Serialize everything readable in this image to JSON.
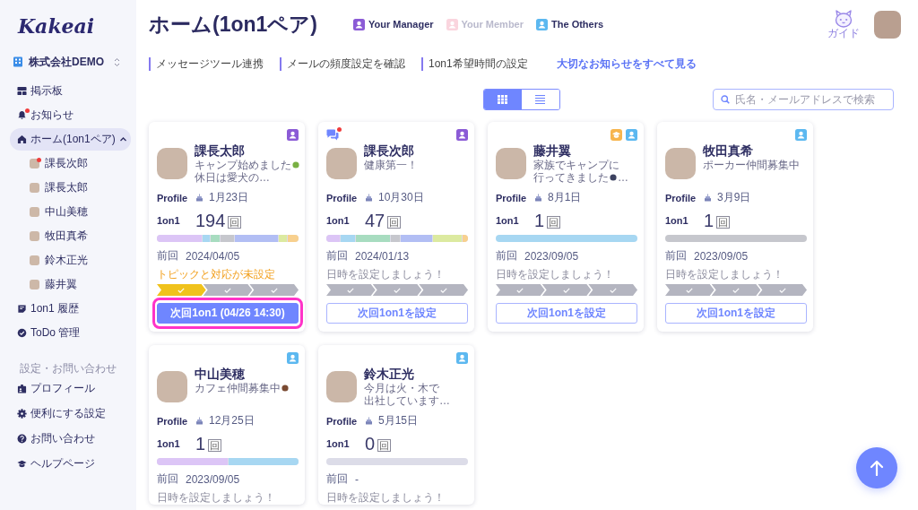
{
  "sidebar": {
    "logo": "Kakeai",
    "company": "株式会社DEMO",
    "items": [
      {
        "label": "掲示板",
        "selected": false,
        "unread": false
      },
      {
        "label": "お知らせ",
        "selected": false,
        "unread": true
      },
      {
        "label": "ホーム(1on1ペア)",
        "selected": true,
        "unread": false,
        "expanded": true,
        "children": [
          {
            "label": "課長次郎",
            "unread": true
          },
          {
            "label": "課長太郎",
            "unread": false
          },
          {
            "label": "中山美穂",
            "unread": false
          },
          {
            "label": "牧田真希",
            "unread": false
          },
          {
            "label": "鈴木正光",
            "unread": false
          },
          {
            "label": "藤井翼",
            "unread": false
          }
        ]
      },
      {
        "label": "1on1 履歴",
        "selected": false,
        "unread": false
      },
      {
        "label": "ToDo 管理",
        "selected": false,
        "unread": false
      }
    ],
    "section_title": "設定・お問い合わせ",
    "settings_items": [
      {
        "label": "プロフィール",
        "selected": false
      },
      {
        "label": "便利にする設定",
        "selected": false
      },
      {
        "label": "お問い合わせ",
        "selected": false
      },
      {
        "label": "ヘルプページ",
        "selected": false
      }
    ]
  },
  "header": {
    "title": "ホーム(1on1ペア)",
    "legend": [
      {
        "label": "Your Manager",
        "kind": "manager",
        "disabled": false
      },
      {
        "label": "Your Member",
        "kind": "member",
        "disabled": true
      },
      {
        "label": "The Others",
        "kind": "other",
        "disabled": false
      }
    ],
    "guide": "ガイド",
    "links": [
      "メッセージツール連携",
      "メールの頻度設定を確認",
      "1on1希望時間の設定"
    ],
    "notice_link": "大切なお知らせをすべて見る",
    "view_toggle": [
      {
        "kind": "grid",
        "selected": true
      },
      {
        "kind": "list",
        "selected": false
      }
    ],
    "search": {
      "placeholder": "氏名・メールアドレスで検索"
    }
  },
  "cards": [
    {
      "name": "課長太郎",
      "unread_message": false,
      "roles": [
        {
          "kind": "manager"
        }
      ],
      "status": [
        [
          {
            "kind": "text",
            "text": "キャンプ始めました"
          },
          {
            "kind": "emoji",
            "color": "#79b043"
          }
        ],
        [
          {
            "kind": "text",
            "text": "休日は愛犬の…"
          }
        ]
      ],
      "profile_label": "Profile",
      "birthday": "1月23日",
      "count_label": "1on1",
      "count": "194",
      "count_unit": "回",
      "last_label": "前回",
      "last_date": "2024/04/05",
      "notice": {
        "text": "トピックと対応が未設定",
        "warning": true
      },
      "steps": [
        {
          "done": true
        },
        {
          "done": false
        },
        {
          "done": false
        }
      ],
      "button": {
        "label": "次回1on1 (04/26 14:30)",
        "filled": true,
        "highlighted": true
      }
    },
    {
      "name": "課長次郎",
      "unread_message": true,
      "roles": [
        {
          "kind": "manager"
        }
      ],
      "status": [
        [
          {
            "kind": "text",
            "text": "健康第一！"
          }
        ]
      ],
      "profile_label": "Profile",
      "birthday": "10月30日",
      "count_label": "1on1",
      "count": "47",
      "count_unit": "回",
      "last_label": "前回",
      "last_date": "2024/01/13",
      "notice": {
        "text": "日時を設定しましょう！",
        "warning": false
      },
      "steps": [
        {
          "done": false
        },
        {
          "done": false
        },
        {
          "done": false
        }
      ],
      "button": {
        "label": "次回1on1を設定",
        "filled": false,
        "highlighted": false
      }
    },
    {
      "name": "藤井翼",
      "unread_message": false,
      "roles": [
        {
          "kind": "mentor"
        },
        {
          "kind": "other"
        }
      ],
      "status": [
        [
          {
            "kind": "text",
            "text": "家族でキャンプに"
          }
        ],
        [
          {
            "kind": "text",
            "text": "行ってきました"
          },
          {
            "kind": "emoji",
            "color": "#3c4260"
          },
          {
            "kind": "text",
            "text": "…"
          }
        ]
      ],
      "profile_label": "Profile",
      "birthday": "8月1日",
      "count_label": "1on1",
      "count": "1",
      "count_unit": "回",
      "last_label": "前回",
      "last_date": "2023/09/05",
      "notice": {
        "text": "日時を設定しましょう！",
        "warning": false
      },
      "steps": [
        {
          "done": false
        },
        {
          "done": false
        },
        {
          "done": false
        }
      ],
      "button": {
        "label": "次回1on1を設定",
        "filled": false,
        "highlighted": false
      }
    },
    {
      "name": "牧田真希",
      "unread_message": false,
      "roles": [
        {
          "kind": "other"
        }
      ],
      "status": [
        [
          {
            "kind": "text",
            "text": "ポーカー仲間募集中"
          }
        ]
      ],
      "profile_label": "Profile",
      "birthday": "3月9日",
      "count_label": "1on1",
      "count": "1",
      "count_unit": "回",
      "last_label": "前回",
      "last_date": "2023/09/05",
      "notice": {
        "text": "日時を設定しましょう！",
        "warning": false
      },
      "steps": [
        {
          "done": false
        },
        {
          "done": false
        },
        {
          "done": false
        }
      ],
      "button": {
        "label": "次回1on1を設定",
        "filled": false,
        "highlighted": false
      }
    },
    {
      "name": "中山美穂",
      "unread_message": false,
      "roles": [
        {
          "kind": "other"
        }
      ],
      "status": [
        [
          {
            "kind": "text",
            "text": "カフェ仲間募集中"
          },
          {
            "kind": "emoji",
            "color": "#7a4a32"
          }
        ]
      ],
      "profile_label": "Profile",
      "birthday": "12月25日",
      "count_label": "1on1",
      "count": "1",
      "count_unit": "回",
      "last_label": "前回",
      "last_date": "2023/09/05",
      "notice": {
        "text": "日時を設定しましょう！",
        "warning": false
      }
    },
    {
      "name": "鈴木正光",
      "unread_message": false,
      "roles": [
        {
          "kind": "other"
        }
      ],
      "status": [
        [
          {
            "kind": "text",
            "text": "今月は火・木で"
          }
        ],
        [
          {
            "kind": "text",
            "text": "出社しています…"
          }
        ]
      ],
      "profile_label": "Profile",
      "birthday": "5月15日",
      "count_label": "1on1",
      "count": "0",
      "count_unit": "回",
      "last_label": "前回",
      "last_date": "-",
      "notice": {
        "text": "日時を設定しましょう！",
        "warning": false
      }
    }
  ]
}
